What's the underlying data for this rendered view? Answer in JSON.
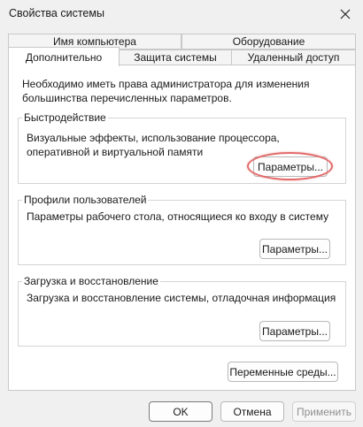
{
  "window": {
    "title": "Свойства системы"
  },
  "tabs": {
    "row1": [
      {
        "label": "Имя компьютера"
      },
      {
        "label": "Оборудование"
      }
    ],
    "row2": [
      {
        "label": "Дополнительно",
        "active": true
      },
      {
        "label": "Защита системы"
      },
      {
        "label": "Удаленный доступ"
      }
    ]
  },
  "panel": {
    "intro": "Необходимо иметь права администратора для изменения большинства перечисленных параметров.",
    "groups": [
      {
        "title": "Быстродействие",
        "description": "Визуальные эффекты, использование процессора, оперативной и виртуальной памяти",
        "button_label": "Параметры..."
      },
      {
        "title": "Профили пользователей",
        "description": "Параметры рабочего стола, относящиеся ко входу в систему",
        "button_label": "Параметры..."
      },
      {
        "title": "Загрузка и восстановление",
        "description": "Загрузка и восстановление системы, отладочная информация",
        "button_label": "Параметры..."
      }
    ],
    "env_button_label": "Переменные среды..."
  },
  "footer": {
    "ok_label": "OK",
    "cancel_label": "Отмена",
    "apply_label": "Применить"
  },
  "colors": {
    "background": "#f0f0f0",
    "panel": "#ffffff",
    "highlight": "#e26a6a"
  },
  "icons": {
    "close": "close-icon"
  }
}
